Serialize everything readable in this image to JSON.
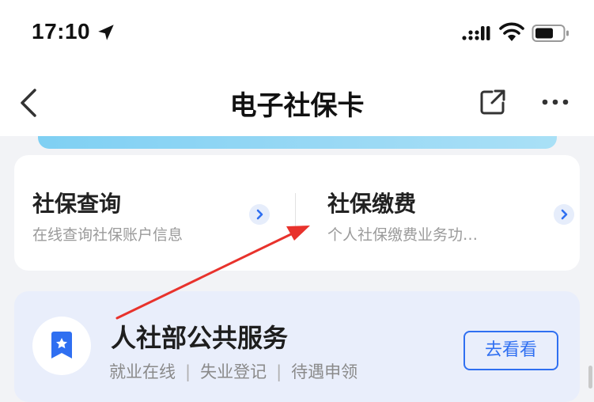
{
  "status_bar": {
    "time": "17:10",
    "icons": [
      "location-arrow-icon",
      "cellular-signal-icon",
      "wifi-icon",
      "battery-icon"
    ]
  },
  "nav": {
    "title": "电子社保卡",
    "icons": [
      "back-chevron-icon",
      "share-icon",
      "more-icon"
    ]
  },
  "services": [
    {
      "title": "社保查询",
      "desc": "在线查询社保账户信息"
    },
    {
      "title": "社保缴费",
      "desc": "个人社保缴费业务功…"
    }
  ],
  "public_service": {
    "title": "人社部公共服务",
    "links": [
      "就业在线",
      "失业登记",
      "待遇申领"
    ],
    "separator": "|",
    "button_label": "去看看"
  },
  "colors": {
    "accent": "#2f6ff1",
    "banner": "#8fd6f4",
    "arrow": "#e8322c",
    "public_card_bg": "#e9eefb"
  }
}
